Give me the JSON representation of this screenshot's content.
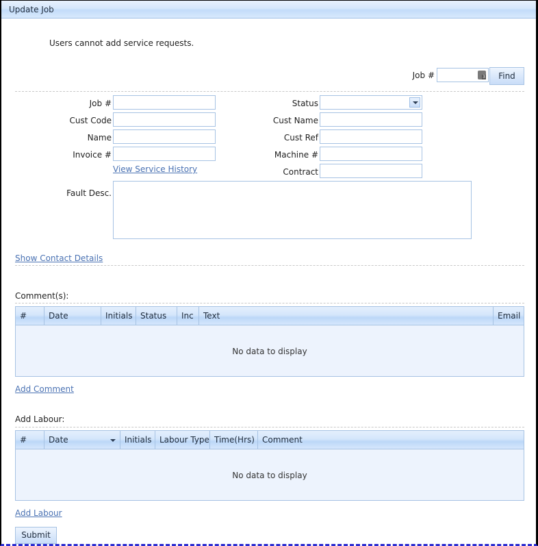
{
  "window": {
    "title": "Update Job"
  },
  "notice": "Users cannot add service requests.",
  "search": {
    "label": "Job #",
    "value": "",
    "find_label": "Find"
  },
  "form": {
    "left": [
      {
        "label": "Job #",
        "value": ""
      },
      {
        "label": "Cust Code",
        "value": ""
      },
      {
        "label": "Name",
        "value": ""
      },
      {
        "label": "Invoice #",
        "value": ""
      }
    ],
    "right": [
      {
        "label": "Status",
        "value": ""
      },
      {
        "label": "Cust Name",
        "value": ""
      },
      {
        "label": "Cust Ref",
        "value": ""
      },
      {
        "label": "Machine #",
        "value": ""
      },
      {
        "label": "Contract",
        "value": ""
      }
    ],
    "view_service_history": "View Service History",
    "fault_desc": {
      "label": "Fault Desc.",
      "value": ""
    }
  },
  "show_contact_details": "Show Contact Details",
  "comments": {
    "heading": "Comment(s):",
    "columns": [
      "#",
      "Date",
      "Initials",
      "Status",
      "Inc",
      "Text",
      "Email"
    ],
    "empty_text": "No data to display",
    "add_link": "Add Comment"
  },
  "labour": {
    "heading": "Add Labour:",
    "columns": [
      "#",
      "Date",
      "Initials",
      "Labour Type",
      "Time(Hrs)",
      "Comment"
    ],
    "empty_text": "No data to display",
    "add_link": "Add Labour"
  },
  "submit_label": "Submit",
  "colors": {
    "accent": "#a6c2e3",
    "link": "#4a72b3",
    "grid_bg": "#edf3fd"
  }
}
